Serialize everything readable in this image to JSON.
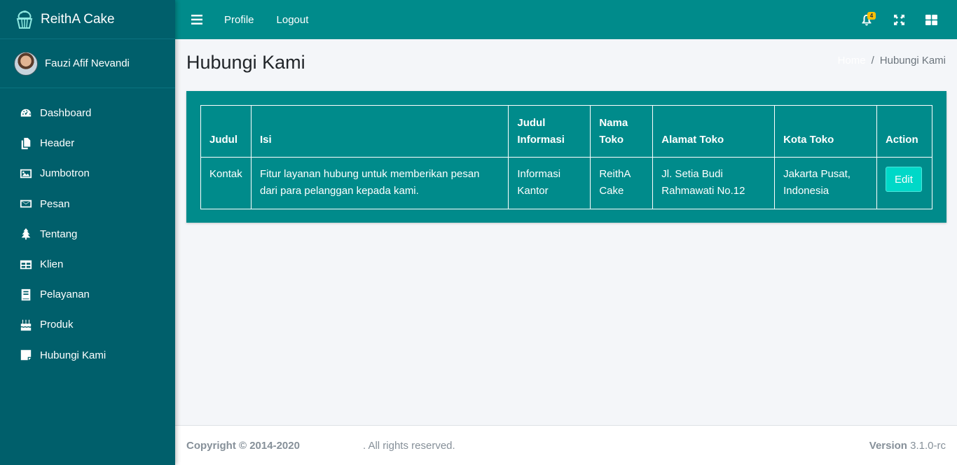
{
  "brand": {
    "name": "ReithA Cake",
    "logo_icon": "cupcake-icon"
  },
  "user": {
    "name": "Fauzi Afif Nevandi"
  },
  "sidebar": {
    "items": [
      {
        "label": "Dashboard",
        "icon": "tachometer-icon"
      },
      {
        "label": "Header",
        "icon": "copy-icon"
      },
      {
        "label": "Jumbotron",
        "icon": "image-icon"
      },
      {
        "label": "Pesan",
        "icon": "envelope-icon"
      },
      {
        "label": "Tentang",
        "icon": "tree-icon"
      },
      {
        "label": "Klien",
        "icon": "table-icon"
      },
      {
        "label": "Pelayanan",
        "icon": "book-icon"
      },
      {
        "label": "Produk",
        "icon": "birthday-cake-icon"
      },
      {
        "label": "Hubungi Kami",
        "icon": "sticky-note-icon"
      }
    ]
  },
  "topbar": {
    "links": [
      "Profile",
      "Logout"
    ],
    "notification_count": "4"
  },
  "page": {
    "title": "Hubungi Kami"
  },
  "breadcrumb": {
    "home": "Home",
    "current": "Hubungi Kami"
  },
  "table": {
    "headers": [
      "Judul",
      "Isi",
      "Judul Informasi",
      "Nama Toko",
      "Alamat Toko",
      "Kota Toko",
      "Action"
    ],
    "rows": [
      {
        "judul": "Kontak",
        "isi": "Fitur layanan hubung untuk memberikan pesan dari para pelanggan kepada kami.",
        "judul_informasi": "Informasi Kantor",
        "nama_toko": "ReithA Cake",
        "alamat_toko": "Jl. Setia Budi Rahmawati No.12",
        "kota_toko": "Jakarta Pusat, Indonesia",
        "action": "Edit"
      }
    ]
  },
  "footer": {
    "copyright": "Copyright © 2014-2020",
    "rights": ". All rights reserved.",
    "version_label": "Version",
    "version": "3.1.0-rc"
  },
  "colors": {
    "sidebar": "#005f6b",
    "topbar": "#008b8b",
    "card": "#008b8b",
    "edit_button": "#00d8c8",
    "badge": "#ffc107"
  }
}
